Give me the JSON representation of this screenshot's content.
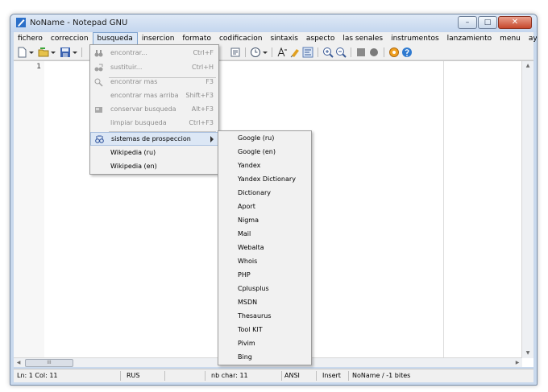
{
  "window": {
    "title": "NoName - Notepad GNU",
    "minimize_glyph": "–",
    "maximize_glyph": "□",
    "close_glyph": "✕"
  },
  "menubar": {
    "items": [
      "fichero",
      "correccion",
      "busqueda",
      "insercion",
      "formato",
      "codificacion",
      "sintaxis",
      "aspecto",
      "las senales",
      "instrumentos",
      "lanzamiento",
      "menu",
      "ayuda"
    ],
    "active": "busqueda"
  },
  "editor": {
    "line_number": "1"
  },
  "search_menu": {
    "items": [
      {
        "label": "encontrar...",
        "shortcut": "Ctrl+F",
        "icon": "binoculars-icon",
        "disabled": true
      },
      {
        "label": "sustituir...",
        "shortcut": "Ctrl+H",
        "icon": "replace-icon",
        "disabled": true
      },
      {
        "label": "encontrar mas",
        "shortcut": "F3",
        "icon": "find-next-icon",
        "disabled": true
      },
      {
        "label": "encontrar mas arriba",
        "shortcut": "Shift+F3",
        "icon": "",
        "disabled": true
      },
      {
        "label": "conservar busqueda",
        "shortcut": "Alt+F3",
        "icon": "pin-search-icon",
        "disabled": true
      },
      {
        "label": "limpiar busqueda",
        "shortcut": "Ctrl+F3",
        "icon": "",
        "disabled": true
      },
      {
        "label": "sistemas de prospeccion",
        "shortcut": "",
        "icon": "search-engines-icon",
        "disabled": false
      },
      {
        "label": "Wikipedia (ru)",
        "shortcut": "",
        "icon": "",
        "disabled": false
      },
      {
        "label": "Wikipedia (en)",
        "shortcut": "",
        "icon": "",
        "disabled": false
      }
    ]
  },
  "search_engines_submenu": {
    "items": [
      "Google (ru)",
      "Google (en)",
      "Yandex",
      "Yandex Dictionary",
      "Dictionary",
      "Aport",
      "Nigma",
      "Mail",
      "Webalta",
      "Whois",
      "PHP",
      "Cplusplus",
      "MSDN",
      "Thesaurus",
      "Tool KIT",
      "Pivim",
      "Bing"
    ]
  },
  "statusbar": {
    "position": "Ln: 1 Col: 11",
    "language": "RUS",
    "char_count": "nb char: 11",
    "encoding": "ANSI",
    "mode": "Insert",
    "file_info": "NoName / -1 bites"
  },
  "scrollbar": {
    "thumb_grip": "III"
  },
  "colors": {
    "highlight": "#dce7f5",
    "titlebar": "#c4d6ee",
    "close_button": "#c6482c"
  }
}
